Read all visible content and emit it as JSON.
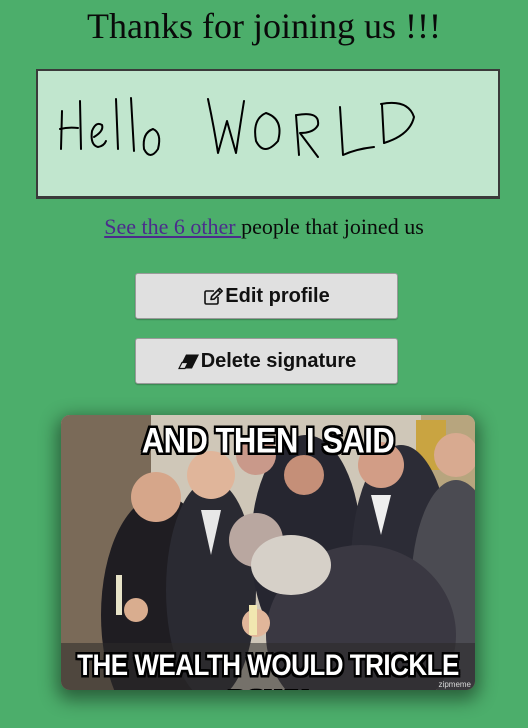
{
  "header": {
    "title": "Thanks for joining us !!!"
  },
  "signature": {
    "handwritten_text": "Hello WORLD"
  },
  "others": {
    "link_text": "See the 6 other ",
    "suffix_text": "people that joined us"
  },
  "actions": {
    "edit_label": "Edit profile",
    "edit_icon": "pencil-square-icon",
    "delete_label": "Delete signature",
    "delete_icon": "eraser-icon"
  },
  "meme": {
    "top_caption": "AND THEN I SAID",
    "bottom_caption": "THE WEALTH WOULD TRICKLE DOWN",
    "watermark": "zipmeme"
  },
  "colors": {
    "background": "#4cae6b",
    "signature_bg": "#c1e6ce",
    "link": "#4b2c8c",
    "button_bg": "#e0e0e0"
  }
}
